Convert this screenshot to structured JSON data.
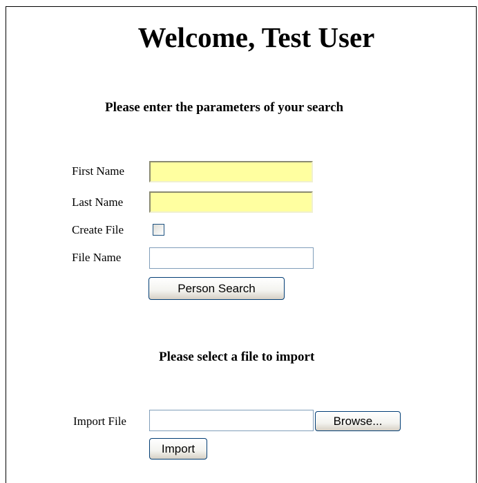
{
  "header": {
    "title": "Welcome, Test User"
  },
  "search": {
    "heading": "Please enter the parameters of your search",
    "first_name_label": "First Name",
    "first_name_value": "",
    "last_name_label": "Last Name",
    "last_name_value": "",
    "create_file_label": "Create File",
    "create_file_checked": false,
    "file_name_label": "File Name",
    "file_name_value": "",
    "search_button_label": "Person Search"
  },
  "import": {
    "heading": "Please select a file to import",
    "import_file_label": "Import File",
    "import_file_value": "",
    "browse_button_label": "Browse...",
    "import_button_label": "Import"
  },
  "colors": {
    "required_field_bg": "#ffffa0",
    "input_border": "#7f9db9",
    "button_border": "#003c74"
  }
}
